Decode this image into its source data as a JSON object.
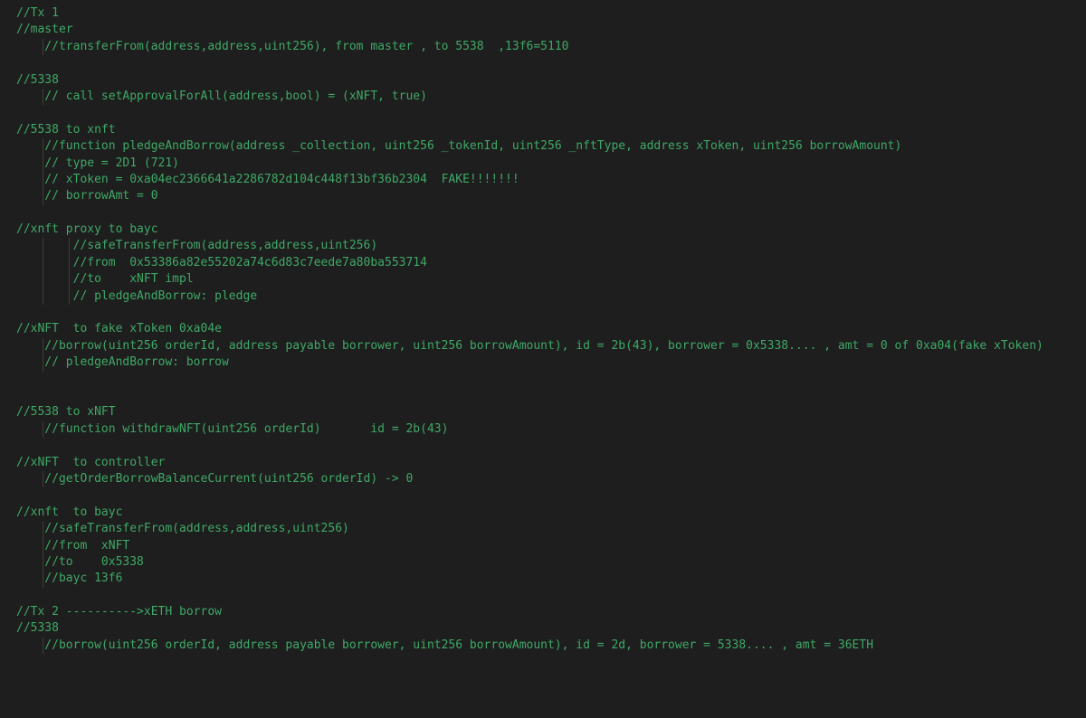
{
  "lines": [
    {
      "indent": 0,
      "bars": 0,
      "text": "//Tx 1"
    },
    {
      "indent": 0,
      "bars": 0,
      "text": "//master"
    },
    {
      "indent": 1,
      "bars": 1,
      "text": "//transferFrom(address,address,uint256), from master , to 5538  ,13f6=5110"
    },
    {
      "indent": 0,
      "bars": 0,
      "text": ""
    },
    {
      "indent": 0,
      "bars": 0,
      "text": "//5338"
    },
    {
      "indent": 1,
      "bars": 1,
      "text": "// call setApprovalForAll(address,bool) = (xNFT, true)"
    },
    {
      "indent": 0,
      "bars": 0,
      "text": ""
    },
    {
      "indent": 0,
      "bars": 0,
      "text": "//5538 to xnft"
    },
    {
      "indent": 1,
      "bars": 1,
      "text": "//function pledgeAndBorrow(address _collection, uint256 _tokenId, uint256 _nftType, address xToken, uint256 borrowAmount)"
    },
    {
      "indent": 1,
      "bars": 1,
      "text": "// type = 2D1 (721)"
    },
    {
      "indent": 1,
      "bars": 1,
      "text": "// xToken = 0xa04ec2366641a2286782d104c448f13bf36b2304  FAKE!!!!!!!"
    },
    {
      "indent": 1,
      "bars": 1,
      "text": "// borrowAmt = 0"
    },
    {
      "indent": 0,
      "bars": 0,
      "text": ""
    },
    {
      "indent": 0,
      "bars": 0,
      "text": "//xnft proxy to bayc"
    },
    {
      "indent": 2,
      "bars": 2,
      "text": "//safeTransferFrom(address,address,uint256)"
    },
    {
      "indent": 2,
      "bars": 2,
      "text": "//from  0x53386a82e55202a74c6d83c7eede7a80ba553714"
    },
    {
      "indent": 2,
      "bars": 2,
      "text": "//to    xNFT impl"
    },
    {
      "indent": 2,
      "bars": 2,
      "text": "// pledgeAndBorrow: pledge"
    },
    {
      "indent": 0,
      "bars": 0,
      "text": ""
    },
    {
      "indent": 0,
      "bars": 0,
      "text": "//xNFT  to fake xToken 0xa04e"
    },
    {
      "indent": 1,
      "bars": 1,
      "text": "//borrow(uint256 orderId, address payable borrower, uint256 borrowAmount), id = 2b(43), borrower = 0x5338.... , amt = 0 of 0xa04(fake xToken)"
    },
    {
      "indent": 1,
      "bars": 1,
      "text": "// pledgeAndBorrow: borrow"
    },
    {
      "indent": 0,
      "bars": 0,
      "text": ""
    },
    {
      "indent": 0,
      "bars": 0,
      "text": ""
    },
    {
      "indent": 0,
      "bars": 0,
      "text": "//5538 to xNFT"
    },
    {
      "indent": 1,
      "bars": 1,
      "text": "//function withdrawNFT(uint256 orderId)       id = 2b(43)"
    },
    {
      "indent": 0,
      "bars": 0,
      "text": ""
    },
    {
      "indent": 0,
      "bars": 0,
      "text": "//xNFT  to controller"
    },
    {
      "indent": 1,
      "bars": 1,
      "text": "//getOrderBorrowBalanceCurrent(uint256 orderId) -> 0"
    },
    {
      "indent": 0,
      "bars": 0,
      "text": ""
    },
    {
      "indent": 0,
      "bars": 0,
      "text": "//xnft  to bayc"
    },
    {
      "indent": 1,
      "bars": 1,
      "text": "//safeTransferFrom(address,address,uint256)"
    },
    {
      "indent": 1,
      "bars": 1,
      "text": "//from  xNFT"
    },
    {
      "indent": 1,
      "bars": 1,
      "text": "//to    0x5338"
    },
    {
      "indent": 1,
      "bars": 1,
      "text": "//bayc 13f6"
    },
    {
      "indent": 0,
      "bars": 0,
      "text": ""
    },
    {
      "indent": 0,
      "bars": 0,
      "text": "//Tx 2 ---------->xETH borrow"
    },
    {
      "indent": 0,
      "bars": 0,
      "text": "//5338"
    },
    {
      "indent": 1,
      "bars": 1,
      "text": "//borrow(uint256 orderId, address payable borrower, uint256 borrowAmount), id = 2d, borrower = 5338.... , amt = 36ETH"
    }
  ]
}
